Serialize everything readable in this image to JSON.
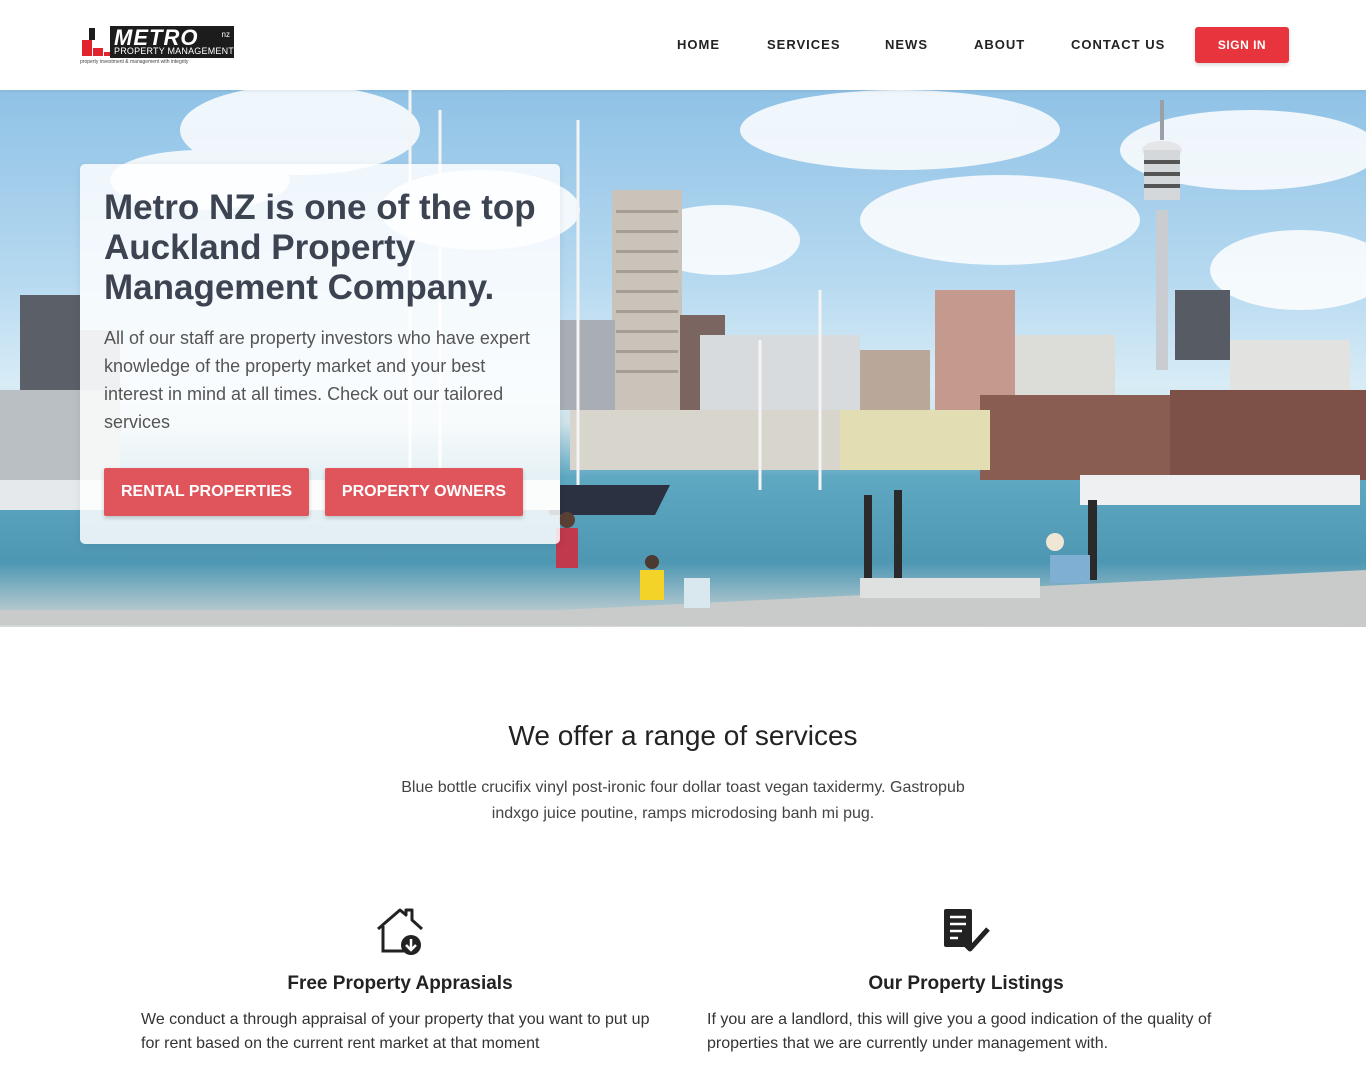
{
  "logo": {
    "word": "METRO",
    "nz": "nz",
    "sub": "PROPERTY MANAGEMENT",
    "tagline": "property investment & management with integrity"
  },
  "nav": {
    "items": [
      "HOME",
      "SERVICES",
      "NEWS",
      "ABOUT",
      "CONTACT US"
    ],
    "signin": "SIGN IN"
  },
  "hero": {
    "title": "Metro NZ is one of the top Auckland Property Management Company.",
    "text": "All of our staff are property investors who have expert knowledge of the property market and your best interest in mind at all times. Check out our tailored services",
    "buttons": [
      "RENTAL PROPERTIES",
      "PROPERTY OWNERS"
    ]
  },
  "services": {
    "title": "We offer a range of services",
    "subtitle": "Blue bottle crucifix vinyl post-ironic four dollar toast vegan taxidermy. Gastropub indxgo juice poutine, ramps microdosing banh mi pug.",
    "items": [
      {
        "icon": "house-download-icon",
        "title": "Free Property Apprasials",
        "text": "We conduct a through appraisal of your property that you want to put up for rent based on the current rent market at that moment"
      },
      {
        "icon": "checklist-icon",
        "title": "Our Property Listings",
        "text": "If you are a landlord, this will give you a good indication of the quality of properties that we are currently under management with."
      }
    ]
  },
  "colors": {
    "accent": "#e8353d",
    "hero_button": "#e0555c",
    "title_text": "#3d4451"
  }
}
